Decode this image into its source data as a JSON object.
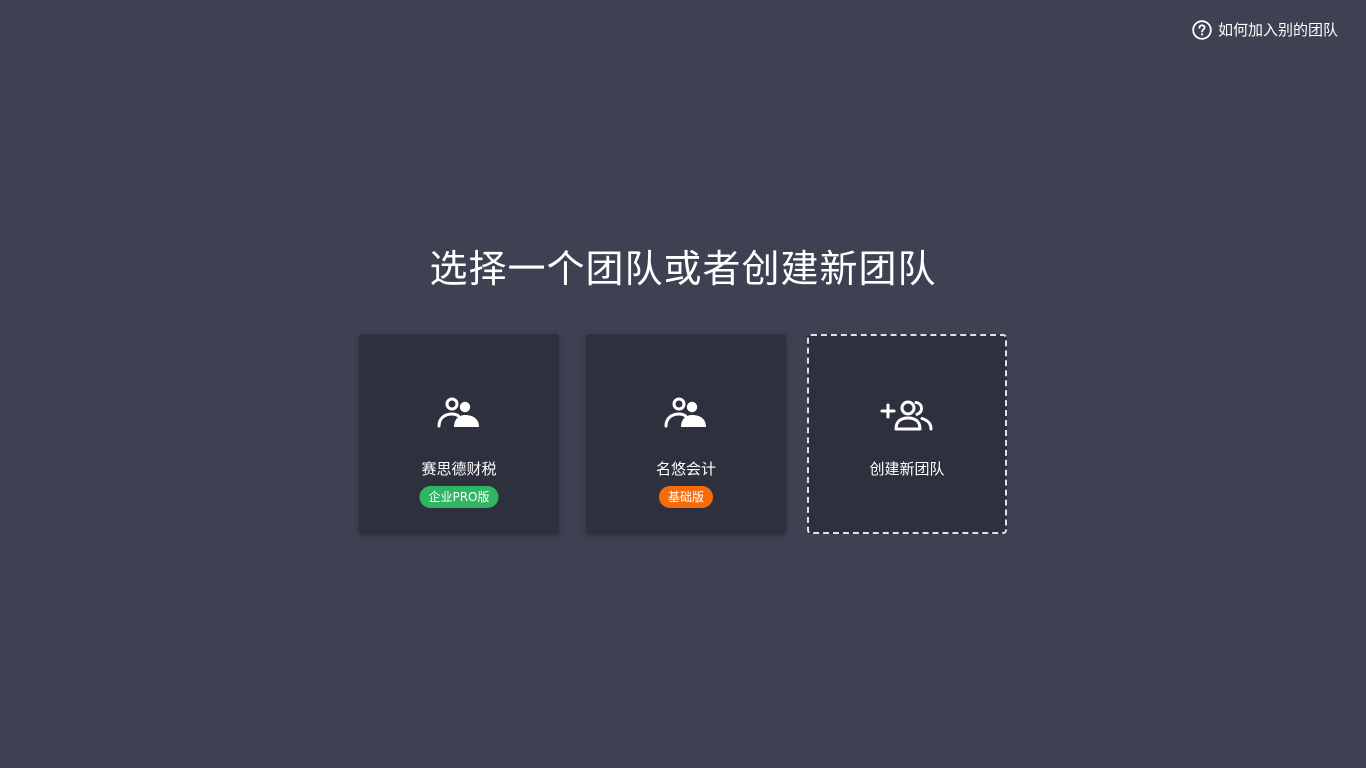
{
  "help": {
    "label": "如何加入别的团队",
    "icon": "question-circle-icon"
  },
  "title": "选择一个团队或者创建新团队",
  "teams": [
    {
      "name": "赛思德财税",
      "badge": "企业PRO版",
      "badge_color": "#2fb563",
      "icon": "team-icon"
    },
    {
      "name": "名悠会计",
      "badge": "基础版",
      "badge_color": "#f56c0a",
      "icon": "team-icon"
    }
  ],
  "create": {
    "label": "创建新团队",
    "icon": "add-team-icon"
  },
  "colors": {
    "background": "#3d4152",
    "card": "#2e303e",
    "text": "#ffffff"
  }
}
